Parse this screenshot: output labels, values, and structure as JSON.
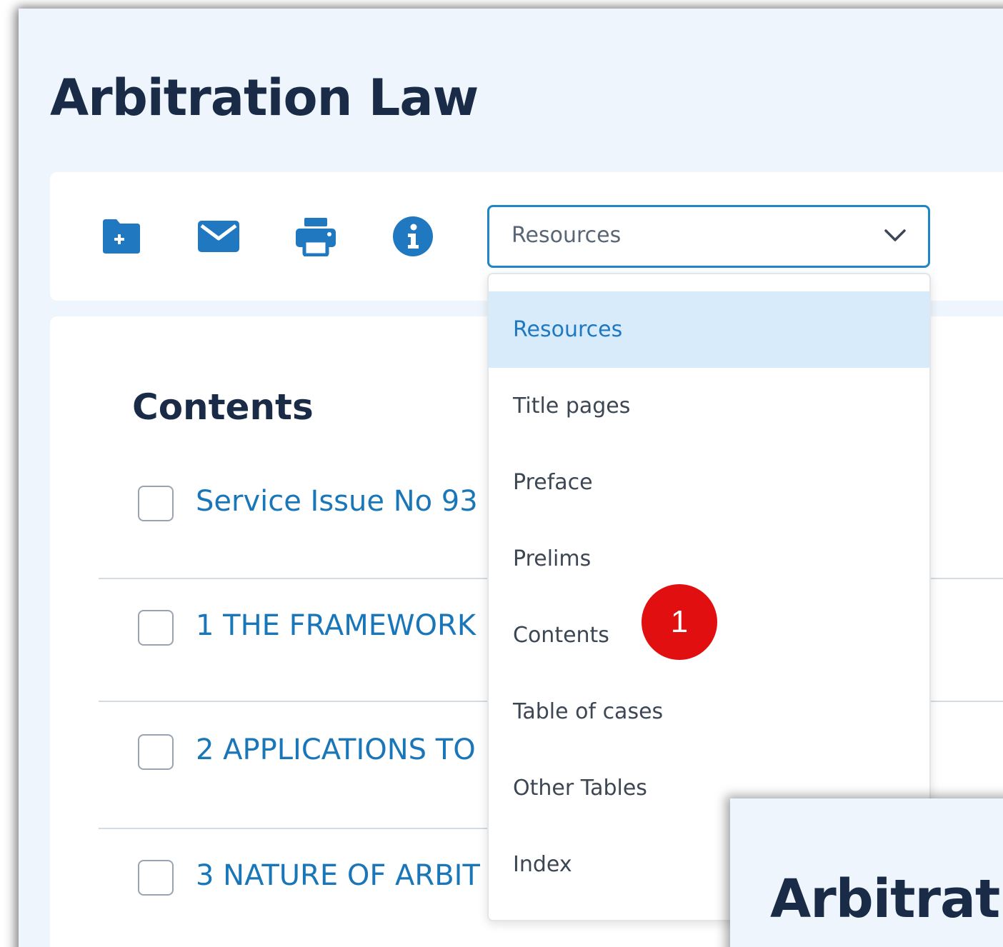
{
  "page": {
    "title": "Arbitration Law"
  },
  "toolbar": {
    "icons": [
      "add-folder-icon",
      "mail-icon",
      "print-icon",
      "info-icon"
    ],
    "accent_color": "#1f78c0"
  },
  "select": {
    "value": "Resources",
    "options": [
      "Resources",
      "Title pages",
      "Preface",
      "Prelims",
      "Contents",
      "Table of cases",
      "Other Tables",
      "Index"
    ],
    "selected_index": 0
  },
  "contents": {
    "heading": "Contents",
    "items": [
      {
        "label": "Service Issue No 93"
      },
      {
        "label": "1 THE FRAMEWORK"
      },
      {
        "label": "2 APPLICATIONS TO"
      },
      {
        "label": "3 NATURE OF ARBIT"
      }
    ]
  },
  "badge": {
    "number": "1",
    "color": "#e10f0f"
  },
  "overlay": {
    "title": "Arbitrat"
  }
}
